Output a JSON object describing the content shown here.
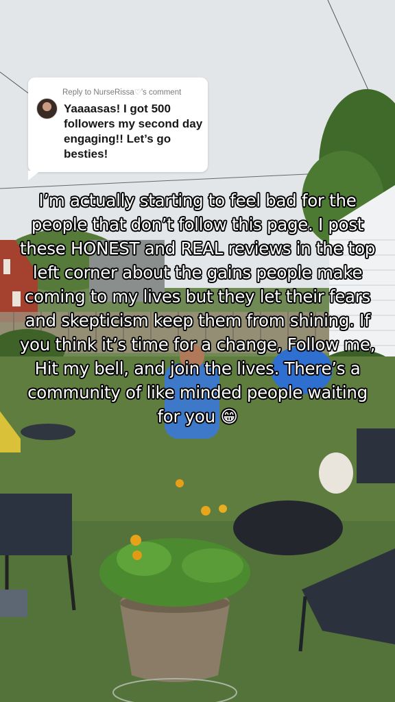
{
  "reply": {
    "header_prefix": "Reply to NurseRissa",
    "header_icon": "stethoscope-heart-icon",
    "header_suffix": "’s comment",
    "text": "Yaaaasas! I got 500 followers my second day engaging!! Let’s go besties!"
  },
  "caption": {
    "text": "I’m actually starting to feel bad for the people that don’t follow this page. I post these HONEST and REAL reviews in the top left corner about the gains people make coming to my lives but they let their fears and skepticism keep them from shining. If you think it’s time for a change, Follow me, Hit my bell, and join the lives. There’s a community of like minded people waiting for you 😁"
  },
  "colors": {
    "sky": "#e4e7ea",
    "lawn": "#5e7d3e",
    "siding": "#f2f3f4",
    "brick": "#a4412f",
    "caption_text": "#ffffff",
    "caption_outline": "#000000"
  }
}
